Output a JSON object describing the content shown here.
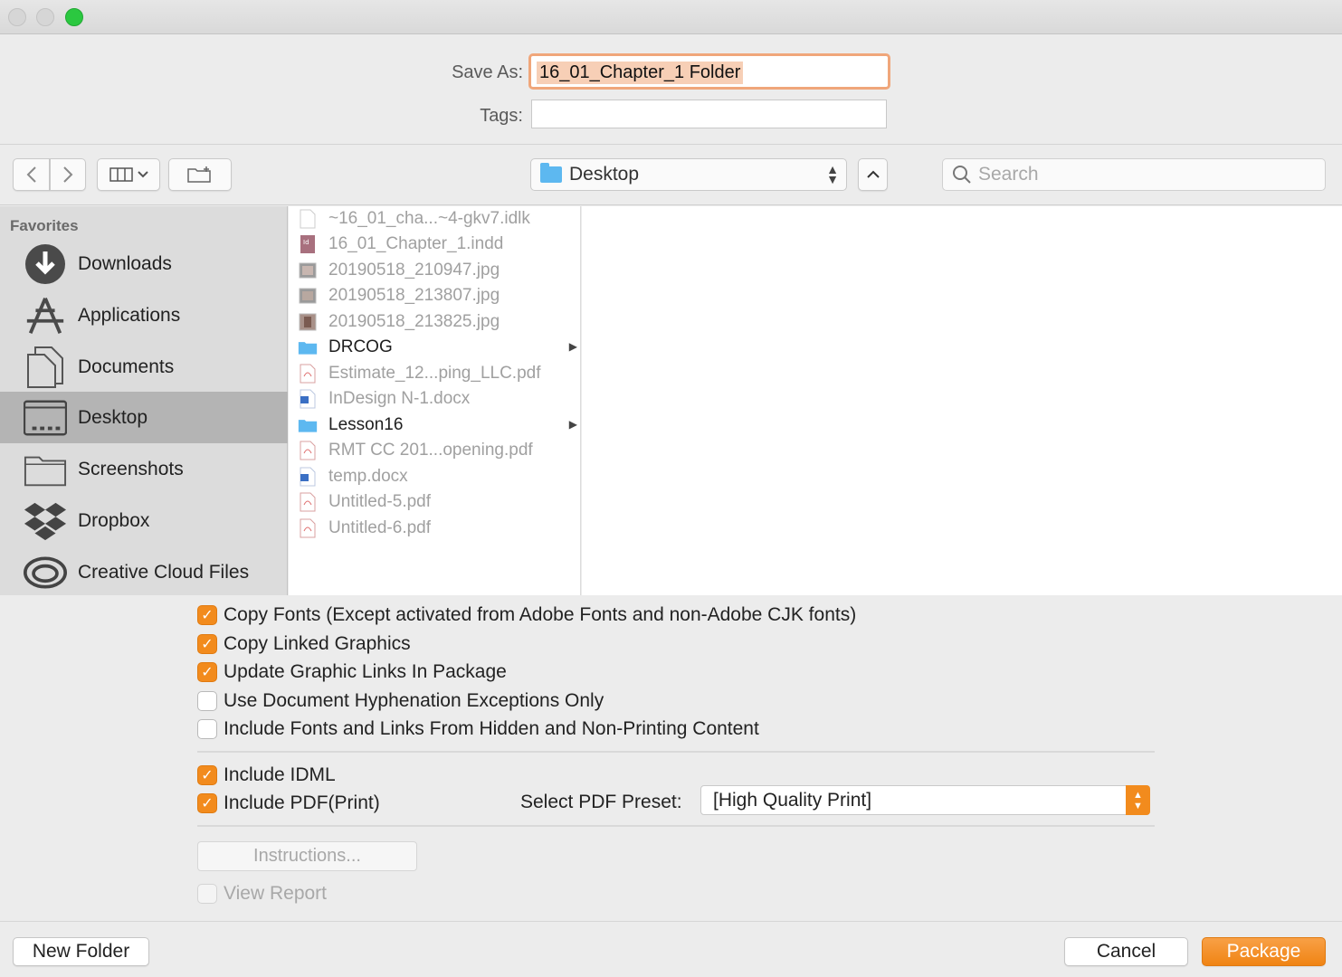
{
  "window": {
    "traffic_lights": [
      "close",
      "minimize",
      "zoom"
    ]
  },
  "top": {
    "save_as_label": "Save As:",
    "save_as_value": "16_01_Chapter_1 Folder",
    "tags_label": "Tags:",
    "tags_value": ""
  },
  "toolbar": {
    "location": "Desktop",
    "search_placeholder": "Search"
  },
  "sidebar": {
    "title": "Favorites",
    "items": [
      {
        "label": "Downloads",
        "icon": "downloads-icon"
      },
      {
        "label": "Applications",
        "icon": "applications-icon"
      },
      {
        "label": "Documents",
        "icon": "documents-icon"
      },
      {
        "label": "Desktop",
        "icon": "desktop-icon",
        "selected": true
      },
      {
        "label": "Screenshots",
        "icon": "folder-icon"
      },
      {
        "label": "Dropbox",
        "icon": "dropbox-icon"
      },
      {
        "label": "Creative Cloud Files",
        "icon": "creative-cloud-icon"
      }
    ]
  },
  "files": [
    {
      "name": "~16_01_cha...~4-gkv7.idlk",
      "type": "generic"
    },
    {
      "name": "16_01_Chapter_1.indd",
      "type": "indd"
    },
    {
      "name": "20190518_210947.jpg",
      "type": "image"
    },
    {
      "name": "20190518_213807.jpg",
      "type": "image"
    },
    {
      "name": "20190518_213825.jpg",
      "type": "image"
    },
    {
      "name": "DRCOG",
      "type": "folder"
    },
    {
      "name": "Estimate_12...ping_LLC.pdf",
      "type": "pdf"
    },
    {
      "name": "InDesign N-1.docx",
      "type": "docx"
    },
    {
      "name": "Lesson16",
      "type": "folder"
    },
    {
      "name": "RMT CC 201...opening.pdf",
      "type": "pdf"
    },
    {
      "name": "temp.docx",
      "type": "docx"
    },
    {
      "name": "Untitled-5.pdf",
      "type": "pdf"
    },
    {
      "name": "Untitled-6.pdf",
      "type": "pdf"
    }
  ],
  "options": {
    "copy_fonts": {
      "label": "Copy Fonts (Except activated from Adobe Fonts and non-Adobe CJK fonts)",
      "checked": true
    },
    "copy_linked_graphics": {
      "label": "Copy Linked Graphics",
      "checked": true
    },
    "update_graphic_links": {
      "label": "Update Graphic Links In Package",
      "checked": true
    },
    "use_hyphenation": {
      "label": "Use Document Hyphenation Exceptions Only",
      "checked": false
    },
    "include_hidden": {
      "label": "Include Fonts and Links From Hidden and Non-Printing Content",
      "checked": false
    },
    "include_idml": {
      "label": "Include IDML",
      "checked": true
    },
    "include_pdf": {
      "label": "Include PDF(Print)",
      "checked": true
    },
    "pdf_preset_label": "Select PDF Preset:",
    "pdf_preset_value": "[High Quality Print]",
    "instructions_label": "Instructions...",
    "view_report": {
      "label": "View Report",
      "checked": false,
      "disabled": true
    }
  },
  "footer": {
    "new_folder": "New Folder",
    "cancel": "Cancel",
    "package": "Package"
  },
  "colors": {
    "accent": "#f28b1d",
    "selection": "#b4b4b4",
    "folder": "#5db8f0"
  }
}
